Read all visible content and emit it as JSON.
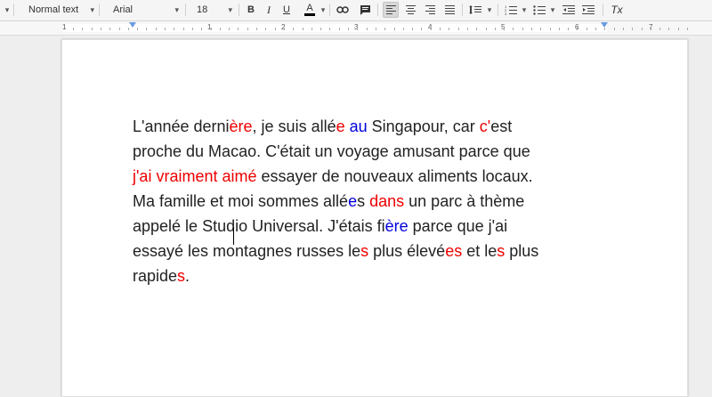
{
  "toolbar": {
    "style_value": "Normal text",
    "font_value": "Arial",
    "size_value": "18",
    "bold_label": "B",
    "italic_label": "I",
    "underline_label": "U",
    "text_color_label": "A",
    "clear_format_label": "Tx"
  },
  "ruler": {
    "numbers": [
      "1",
      "1",
      "2",
      "3",
      "4",
      "5",
      "6",
      "7"
    ]
  },
  "colors": {
    "red": "#ee0000",
    "blue": "#0000dd"
  },
  "document": {
    "lines": [
      [
        {
          "t": "L'année derni",
          "c": ""
        },
        {
          "t": "ère",
          "c": "red"
        },
        {
          "t": ", je suis allé",
          "c": ""
        },
        {
          "t": "e",
          "c": "red"
        },
        {
          "t": " ",
          "c": ""
        },
        {
          "t": "au",
          "c": "blue"
        },
        {
          "t": " Singapour, car ",
          "c": ""
        },
        {
          "t": "c'",
          "c": "red"
        },
        {
          "t": "est",
          "c": ""
        }
      ],
      [
        {
          "t": "proche du Macao. C'était un voyage amusant parce que",
          "c": ""
        }
      ],
      [
        {
          "t": "j'ai vraiment aimé",
          "c": "red"
        },
        {
          "t": " essayer de nouveaux aliments locaux.",
          "c": ""
        }
      ],
      [
        {
          "t": "Ma famille et moi sommes allé",
          "c": ""
        },
        {
          "t": "e",
          "c": "blue"
        },
        {
          "t": "s ",
          "c": ""
        },
        {
          "t": "dans",
          "c": "red"
        },
        {
          "t": " un parc à thème",
          "c": ""
        }
      ],
      [
        {
          "t": "appelé le Studio Universal. J'étais fi",
          "c": ""
        },
        {
          "t": "ère",
          "c": "blue"
        },
        {
          "t": " parce que j'ai",
          "c": ""
        }
      ],
      [
        {
          "t": "essayé les montagnes russes le",
          "c": ""
        },
        {
          "t": "s",
          "c": "red"
        },
        {
          "t": " plus élevé",
          "c": ""
        },
        {
          "t": "es",
          "c": "red"
        },
        {
          "t": " et le",
          "c": ""
        },
        {
          "t": "s",
          "c": "red"
        },
        {
          "t": " plus",
          "c": ""
        }
      ],
      [
        {
          "t": "rapide",
          "c": ""
        },
        {
          "t": "s",
          "c": "red"
        },
        {
          "t": ".",
          "c": ""
        }
      ]
    ]
  }
}
